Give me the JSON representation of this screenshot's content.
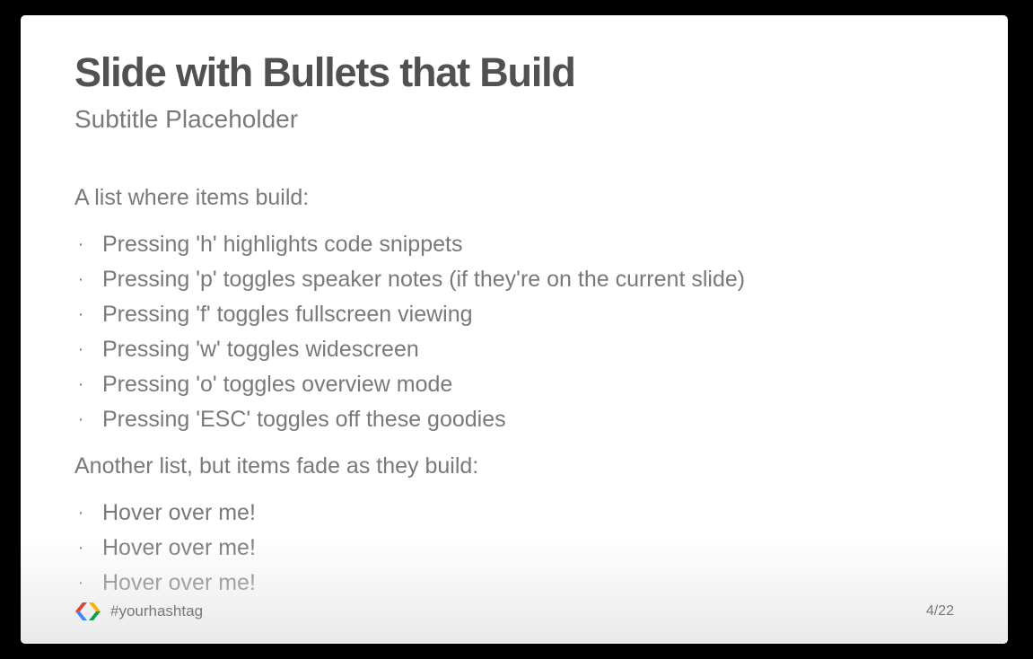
{
  "slide": {
    "title": "Slide with Bullets that Build",
    "subtitle": "Subtitle Placeholder",
    "intro_first": "A list where items build:",
    "list_first": [
      "Pressing 'h' highlights code snippets",
      "Pressing 'p' toggles speaker notes (if they're on the current slide)",
      "Pressing 'f' toggles fullscreen viewing",
      "Pressing 'w' toggles widescreen",
      "Pressing 'o' toggles overview mode",
      "Pressing 'ESC' toggles off these goodies"
    ],
    "intro_second": "Another list, but items fade as they build:",
    "list_second": [
      "Hover over me!",
      "Hover over me!",
      "Hover over me!"
    ],
    "bullet_glyph": "·"
  },
  "footer": {
    "logo_icon": "google-developers-logo-icon",
    "hashtag": "#yourhashtag",
    "slide_number": "4/22"
  },
  "colors": {
    "background": "#000000",
    "slide_bg": "#ffffff",
    "title": "#515151",
    "text": "#797979",
    "logo_red": "#db4437",
    "logo_blue": "#4285f4",
    "logo_green": "#0f9d58",
    "logo_yellow": "#f4b400"
  }
}
